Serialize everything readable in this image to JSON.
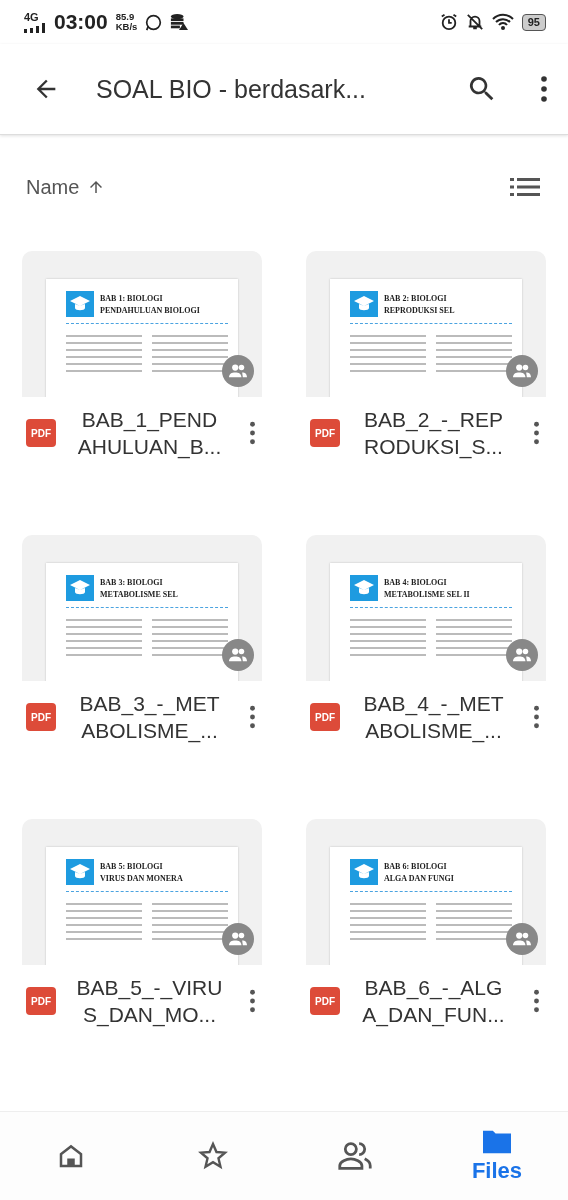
{
  "status_bar": {
    "network": "4G",
    "time": "03:00",
    "speed_value": "85.9",
    "speed_unit": "KB/s",
    "battery": "95"
  },
  "app_bar": {
    "title": "SOAL BIO - berdasark..."
  },
  "sort": {
    "label": "Name"
  },
  "files": [
    {
      "name": "BAB_1_PEND\nAHULUAN_B...",
      "type": "PDF",
      "doc_title": "BAB 1: BIOLOGI",
      "doc_subtitle": "PENDAHULUAN BIOLOGI"
    },
    {
      "name": "BAB_2_-_REP\nRODUKSI_S...",
      "type": "PDF",
      "doc_title": "BAB 2: BIOLOGI",
      "doc_subtitle": "REPRODUKSI SEL"
    },
    {
      "name": "BAB_3_-_MET\nABOLISME_...",
      "type": "PDF",
      "doc_title": "BAB 3: BIOLOGI",
      "doc_subtitle": "METABOLISME SEL"
    },
    {
      "name": "BAB_4_-_MET\nABOLISME_...",
      "type": "PDF",
      "doc_title": "BAB 4: BIOLOGI",
      "doc_subtitle": "METABOLISME SEL II"
    },
    {
      "name": "BAB_5_-_VIRU\nS_DAN_MO...",
      "type": "PDF",
      "doc_title": "BAB 5: BIOLOGI",
      "doc_subtitle": "VIRUS DAN MONERA"
    },
    {
      "name": "BAB_6_-_ALG\nA_DAN_FUN...",
      "type": "PDF",
      "doc_title": "BAB 6: BIOLOGI",
      "doc_subtitle": "ALGA DAN FUNGI"
    }
  ],
  "bottom_nav": [
    {
      "kind": "home",
      "selected": false
    },
    {
      "kind": "starred",
      "selected": false
    },
    {
      "kind": "shared",
      "selected": false
    },
    {
      "kind": "files",
      "label": "Files",
      "selected": true
    }
  ]
}
